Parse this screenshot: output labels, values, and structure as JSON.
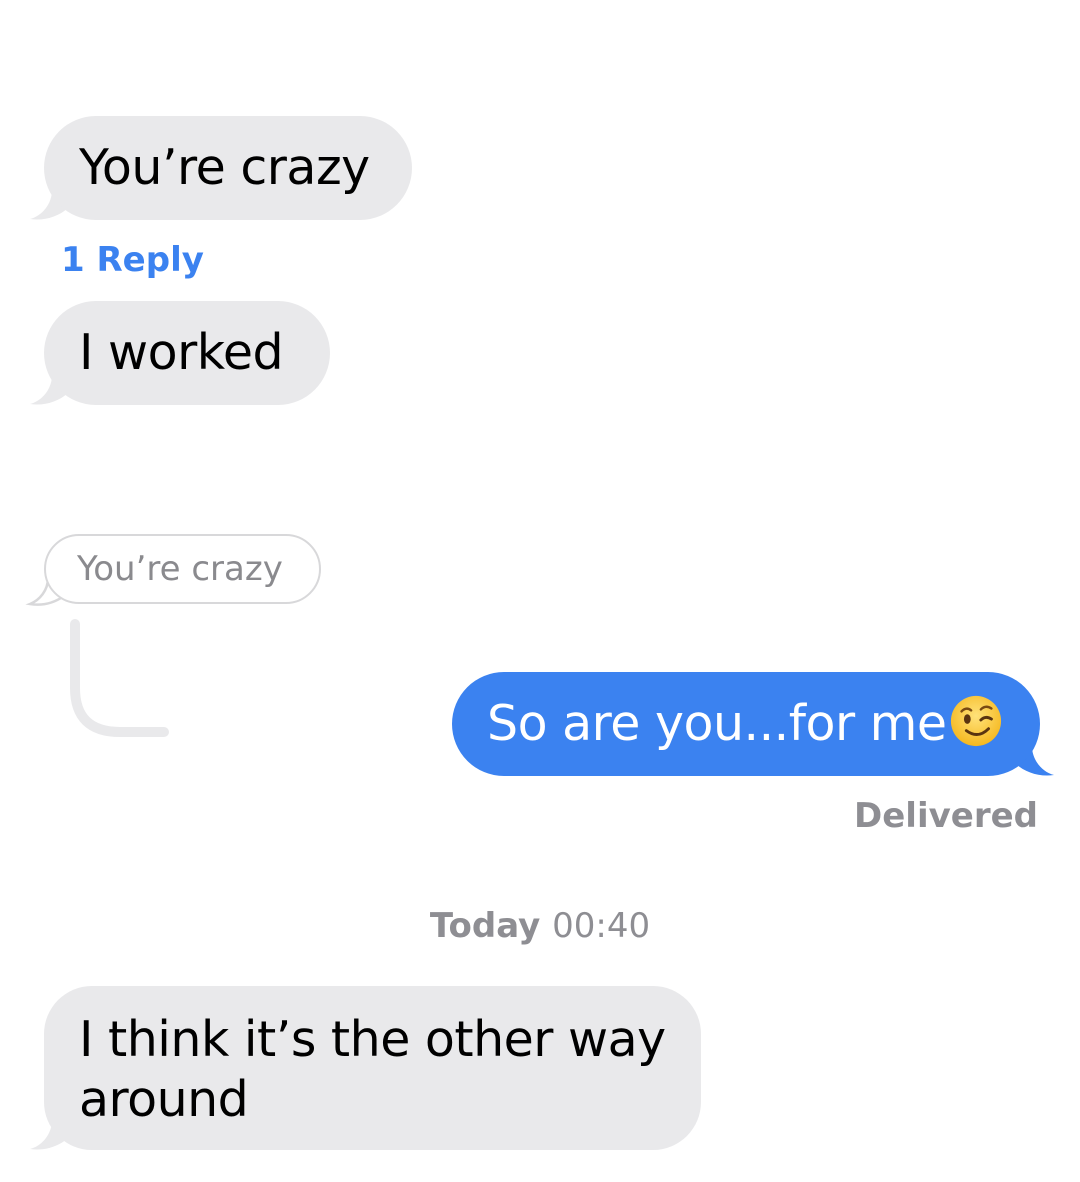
{
  "messages": [
    {
      "direction": "incoming",
      "text": "You’re crazy"
    },
    {
      "direction": "incoming",
      "text": "I worked"
    },
    {
      "direction": "outgoing",
      "text": "So are you...for me",
      "emoji": "winking-face-icon"
    },
    {
      "direction": "incoming",
      "text": "I think it’s the other way around"
    }
  ],
  "thread_reply": {
    "link_label": "1 Reply",
    "quoted_text": "You’re crazy"
  },
  "status": "Delivered",
  "timestamp": {
    "day": "Today",
    "time": "00:40"
  },
  "colors": {
    "incoming_bubble": "#e9e9eb",
    "outgoing_bubble": "#3b82f0",
    "link": "#3b82f0",
    "meta_text": "#8e8e93"
  }
}
